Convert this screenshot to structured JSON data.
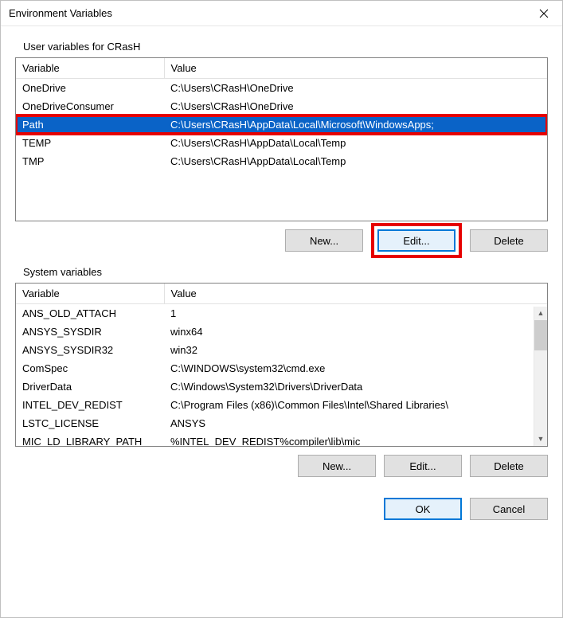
{
  "title": "Environment Variables",
  "user_section": {
    "label": "User variables for CRasH",
    "columns": {
      "var": "Variable",
      "val": "Value"
    },
    "rows": [
      {
        "var": "OneDrive",
        "val": "C:\\Users\\CRasH\\OneDrive"
      },
      {
        "var": "OneDriveConsumer",
        "val": "C:\\Users\\CRasH\\OneDrive"
      },
      {
        "var": "Path",
        "val": "C:\\Users\\CRasH\\AppData\\Local\\Microsoft\\WindowsApps;"
      },
      {
        "var": "TEMP",
        "val": "C:\\Users\\CRasH\\AppData\\Local\\Temp"
      },
      {
        "var": "TMP",
        "val": "C:\\Users\\CRasH\\AppData\\Local\\Temp"
      }
    ],
    "buttons": {
      "new": "New...",
      "edit": "Edit...",
      "delete": "Delete"
    }
  },
  "sys_section": {
    "label": "System variables",
    "columns": {
      "var": "Variable",
      "val": "Value"
    },
    "rows": [
      {
        "var": "ANS_OLD_ATTACH",
        "val": "1"
      },
      {
        "var": "ANSYS_SYSDIR",
        "val": "winx64"
      },
      {
        "var": "ANSYS_SYSDIR32",
        "val": "win32"
      },
      {
        "var": "ComSpec",
        "val": "C:\\WINDOWS\\system32\\cmd.exe"
      },
      {
        "var": "DriverData",
        "val": "C:\\Windows\\System32\\Drivers\\DriverData"
      },
      {
        "var": "INTEL_DEV_REDIST",
        "val": "C:\\Program Files (x86)\\Common Files\\Intel\\Shared Libraries\\"
      },
      {
        "var": "LSTC_LICENSE",
        "val": "ANSYS"
      },
      {
        "var": "MIC_LD_LIBRARY_PATH",
        "val": "%INTEL_DEV_REDIST%compiler\\lib\\mic"
      }
    ],
    "buttons": {
      "new": "New...",
      "edit": "Edit...",
      "delete": "Delete"
    }
  },
  "bottom": {
    "ok": "OK",
    "cancel": "Cancel"
  }
}
